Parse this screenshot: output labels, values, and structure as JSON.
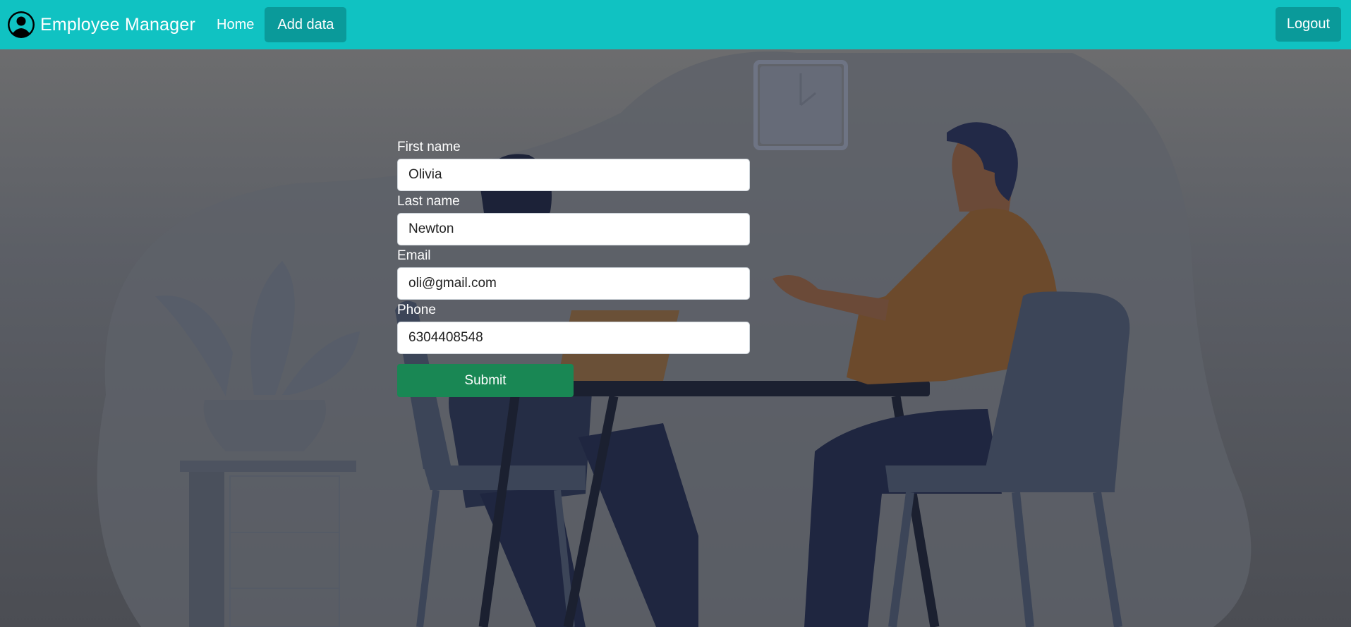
{
  "navbar": {
    "brand": "Employee Manager",
    "home": "Home",
    "add_data": "Add data",
    "logout": "Logout"
  },
  "form": {
    "first_name_label": "First name",
    "first_name_value": "Olivia",
    "last_name_label": "Last name",
    "last_name_value": "Newton",
    "email_label": "Email",
    "email_value": "oli@gmail.com",
    "phone_label": "Phone",
    "phone_value": "6304408548",
    "submit": "Submit"
  },
  "icons": {
    "brand": "user-circle-icon"
  },
  "colors": {
    "navbar": "#10c2c2",
    "nav_button": "#0a9a9a",
    "submit": "#198754"
  }
}
